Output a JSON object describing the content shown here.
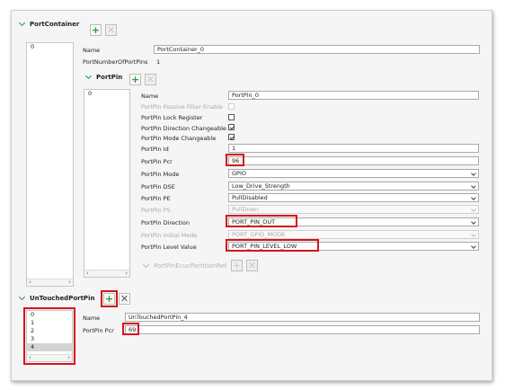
{
  "port_container": {
    "title": "PortContainer",
    "list_items": [
      "0"
    ],
    "name_label": "Name",
    "name_value": "PortContainer_0",
    "number_label": "PortNumberOfPortPins",
    "number_value": "1"
  },
  "port_pin": {
    "title": "PortPin",
    "list_items": [
      "0"
    ],
    "fields": {
      "name": {
        "label": "Name",
        "value": "PortPin_0"
      },
      "passive_filter": {
        "label": "PortPin Passive Filter Enable",
        "checked": false
      },
      "lock_register": {
        "label": "PortPin Lock Register",
        "checked": false
      },
      "direction_changeable": {
        "label": "PortPin Direction Changeable",
        "checked": true
      },
      "mode_changeable": {
        "label": "PortPin Mode Changeable",
        "checked": true
      },
      "id": {
        "label": "PortPin Id",
        "value": "1"
      },
      "pcr": {
        "label": "PortPin Pcr",
        "value": "96"
      },
      "mode": {
        "label": "PortPin Mode",
        "value": "GPIO"
      },
      "dse": {
        "label": "PortPin DSE",
        "value": "Low_Drive_Strength"
      },
      "pe": {
        "label": "PortPin PE",
        "value": "PullDisabled"
      },
      "ps": {
        "label": "PortPin PS",
        "value": "PullDown"
      },
      "direction": {
        "label": "PortPin Direction",
        "value": "PORT_PIN_OUT"
      },
      "initial_mode": {
        "label": "PortPin Initial Mode",
        "value": "PORT_GPIO_MODE"
      },
      "level_value": {
        "label": "PortPin Level Value",
        "value": "PORT_PIN_LEVEL_LOW"
      }
    },
    "subsection": "PortPinEcucPartitionRef"
  },
  "untouched": {
    "title": "UnTouchedPortPin",
    "list_items": [
      "0",
      "1",
      "2",
      "3",
      "4"
    ],
    "name_label": "Name",
    "name_value": "UnTouchedPortPin_4",
    "pcr_label": "PortPin Pcr",
    "pcr_value": "69"
  },
  "icons": {
    "add": "+",
    "remove": "✕",
    "scroll_left": "‹",
    "scroll_right": "›"
  },
  "colors": {
    "highlight": "#d4141e",
    "add_green": "#2f9a3a",
    "chevron": "#2a8a8a"
  }
}
